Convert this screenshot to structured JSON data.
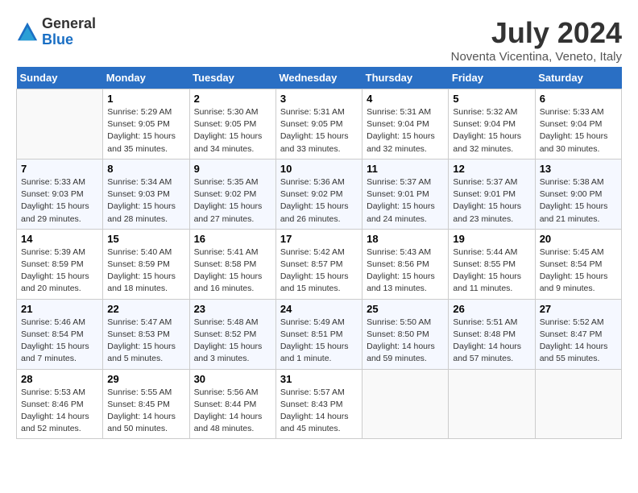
{
  "header": {
    "logo_general": "General",
    "logo_blue": "Blue",
    "month_year": "July 2024",
    "location": "Noventa Vicentina, Veneto, Italy"
  },
  "days_of_week": [
    "Sunday",
    "Monday",
    "Tuesday",
    "Wednesday",
    "Thursday",
    "Friday",
    "Saturday"
  ],
  "weeks": [
    [
      {
        "num": "",
        "info": ""
      },
      {
        "num": "1",
        "info": "Sunrise: 5:29 AM\nSunset: 9:05 PM\nDaylight: 15 hours\nand 35 minutes."
      },
      {
        "num": "2",
        "info": "Sunrise: 5:30 AM\nSunset: 9:05 PM\nDaylight: 15 hours\nand 34 minutes."
      },
      {
        "num": "3",
        "info": "Sunrise: 5:31 AM\nSunset: 9:05 PM\nDaylight: 15 hours\nand 33 minutes."
      },
      {
        "num": "4",
        "info": "Sunrise: 5:31 AM\nSunset: 9:04 PM\nDaylight: 15 hours\nand 32 minutes."
      },
      {
        "num": "5",
        "info": "Sunrise: 5:32 AM\nSunset: 9:04 PM\nDaylight: 15 hours\nand 32 minutes."
      },
      {
        "num": "6",
        "info": "Sunrise: 5:33 AM\nSunset: 9:04 PM\nDaylight: 15 hours\nand 30 minutes."
      }
    ],
    [
      {
        "num": "7",
        "info": "Sunrise: 5:33 AM\nSunset: 9:03 PM\nDaylight: 15 hours\nand 29 minutes."
      },
      {
        "num": "8",
        "info": "Sunrise: 5:34 AM\nSunset: 9:03 PM\nDaylight: 15 hours\nand 28 minutes."
      },
      {
        "num": "9",
        "info": "Sunrise: 5:35 AM\nSunset: 9:02 PM\nDaylight: 15 hours\nand 27 minutes."
      },
      {
        "num": "10",
        "info": "Sunrise: 5:36 AM\nSunset: 9:02 PM\nDaylight: 15 hours\nand 26 minutes."
      },
      {
        "num": "11",
        "info": "Sunrise: 5:37 AM\nSunset: 9:01 PM\nDaylight: 15 hours\nand 24 minutes."
      },
      {
        "num": "12",
        "info": "Sunrise: 5:37 AM\nSunset: 9:01 PM\nDaylight: 15 hours\nand 23 minutes."
      },
      {
        "num": "13",
        "info": "Sunrise: 5:38 AM\nSunset: 9:00 PM\nDaylight: 15 hours\nand 21 minutes."
      }
    ],
    [
      {
        "num": "14",
        "info": "Sunrise: 5:39 AM\nSunset: 8:59 PM\nDaylight: 15 hours\nand 20 minutes."
      },
      {
        "num": "15",
        "info": "Sunrise: 5:40 AM\nSunset: 8:59 PM\nDaylight: 15 hours\nand 18 minutes."
      },
      {
        "num": "16",
        "info": "Sunrise: 5:41 AM\nSunset: 8:58 PM\nDaylight: 15 hours\nand 16 minutes."
      },
      {
        "num": "17",
        "info": "Sunrise: 5:42 AM\nSunset: 8:57 PM\nDaylight: 15 hours\nand 15 minutes."
      },
      {
        "num": "18",
        "info": "Sunrise: 5:43 AM\nSunset: 8:56 PM\nDaylight: 15 hours\nand 13 minutes."
      },
      {
        "num": "19",
        "info": "Sunrise: 5:44 AM\nSunset: 8:55 PM\nDaylight: 15 hours\nand 11 minutes."
      },
      {
        "num": "20",
        "info": "Sunrise: 5:45 AM\nSunset: 8:54 PM\nDaylight: 15 hours\nand 9 minutes."
      }
    ],
    [
      {
        "num": "21",
        "info": "Sunrise: 5:46 AM\nSunset: 8:54 PM\nDaylight: 15 hours\nand 7 minutes."
      },
      {
        "num": "22",
        "info": "Sunrise: 5:47 AM\nSunset: 8:53 PM\nDaylight: 15 hours\nand 5 minutes."
      },
      {
        "num": "23",
        "info": "Sunrise: 5:48 AM\nSunset: 8:52 PM\nDaylight: 15 hours\nand 3 minutes."
      },
      {
        "num": "24",
        "info": "Sunrise: 5:49 AM\nSunset: 8:51 PM\nDaylight: 15 hours\nand 1 minute."
      },
      {
        "num": "25",
        "info": "Sunrise: 5:50 AM\nSunset: 8:50 PM\nDaylight: 14 hours\nand 59 minutes."
      },
      {
        "num": "26",
        "info": "Sunrise: 5:51 AM\nSunset: 8:48 PM\nDaylight: 14 hours\nand 57 minutes."
      },
      {
        "num": "27",
        "info": "Sunrise: 5:52 AM\nSunset: 8:47 PM\nDaylight: 14 hours\nand 55 minutes."
      }
    ],
    [
      {
        "num": "28",
        "info": "Sunrise: 5:53 AM\nSunset: 8:46 PM\nDaylight: 14 hours\nand 52 minutes."
      },
      {
        "num": "29",
        "info": "Sunrise: 5:55 AM\nSunset: 8:45 PM\nDaylight: 14 hours\nand 50 minutes."
      },
      {
        "num": "30",
        "info": "Sunrise: 5:56 AM\nSunset: 8:44 PM\nDaylight: 14 hours\nand 48 minutes."
      },
      {
        "num": "31",
        "info": "Sunrise: 5:57 AM\nSunset: 8:43 PM\nDaylight: 14 hours\nand 45 minutes."
      },
      {
        "num": "",
        "info": ""
      },
      {
        "num": "",
        "info": ""
      },
      {
        "num": "",
        "info": ""
      }
    ]
  ]
}
